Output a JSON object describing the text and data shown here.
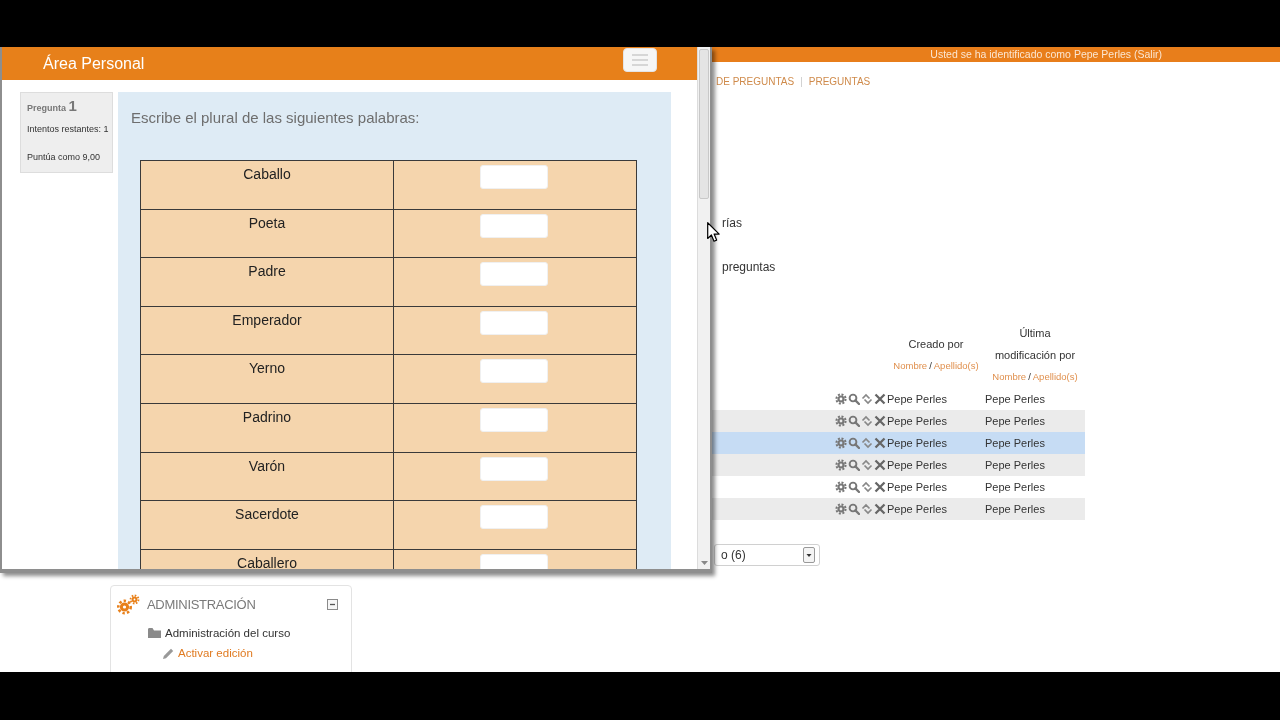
{
  "background_page": {
    "header": {
      "login_text": "Usted se ha identificado como Pepe Perles (Salir)"
    },
    "breadcrumb": {
      "items": [
        "DE PREGUNTAS",
        "PREGUNTAS"
      ],
      "separator": "|"
    },
    "partial_items": [
      "rías",
      "preguntas"
    ],
    "question_table": {
      "columns": [
        {
          "title": "Creado por",
          "sort_links": [
            "Nombre",
            "Apellido(s)"
          ],
          "sort_separator": "/"
        },
        {
          "title": "Última modificación por",
          "sort_links": [
            "Nombre",
            "Apellido(s)"
          ],
          "sort_separator": "/"
        }
      ],
      "rows": [
        {
          "created_by": "Pepe Perles",
          "modified_by": "Pepe Perles",
          "highlighted": false
        },
        {
          "created_by": "Pepe Perles",
          "modified_by": "Pepe Perles",
          "highlighted": false
        },
        {
          "created_by": "Pepe Perles",
          "modified_by": "Pepe Perles",
          "highlighted": true
        },
        {
          "created_by": "Pepe Perles",
          "modified_by": "Pepe Perles",
          "highlighted": false
        },
        {
          "created_by": "Pepe Perles",
          "modified_by": "Pepe Perles",
          "highlighted": false
        },
        {
          "created_by": "Pepe Perles",
          "modified_by": "Pepe Perles",
          "highlighted": false
        }
      ]
    },
    "page_size_select": {
      "value": "o (6)"
    },
    "admin_block": {
      "title": "ADMINISTRACIÓN",
      "expanded": true,
      "items": [
        {
          "label": "Administración del curso",
          "kind": "branch",
          "children": [
            {
              "label": "Activar edición",
              "kind": "action"
            }
          ]
        }
      ]
    }
  },
  "popup": {
    "header": {
      "title": "Área Personal"
    },
    "question_info": {
      "label": "Pregunta",
      "number": "1",
      "attempts": "Intentos restantes: 1",
      "score": "Puntúa como 9,00"
    },
    "question": {
      "prompt": "Escribe el plural de las siguientes palabras:",
      "words": [
        "Caballo",
        "Poeta",
        "Padre",
        "Emperador",
        "Yerno",
        "Padrino",
        "Varón",
        "Sacerdote",
        "Caballero"
      ]
    }
  }
}
